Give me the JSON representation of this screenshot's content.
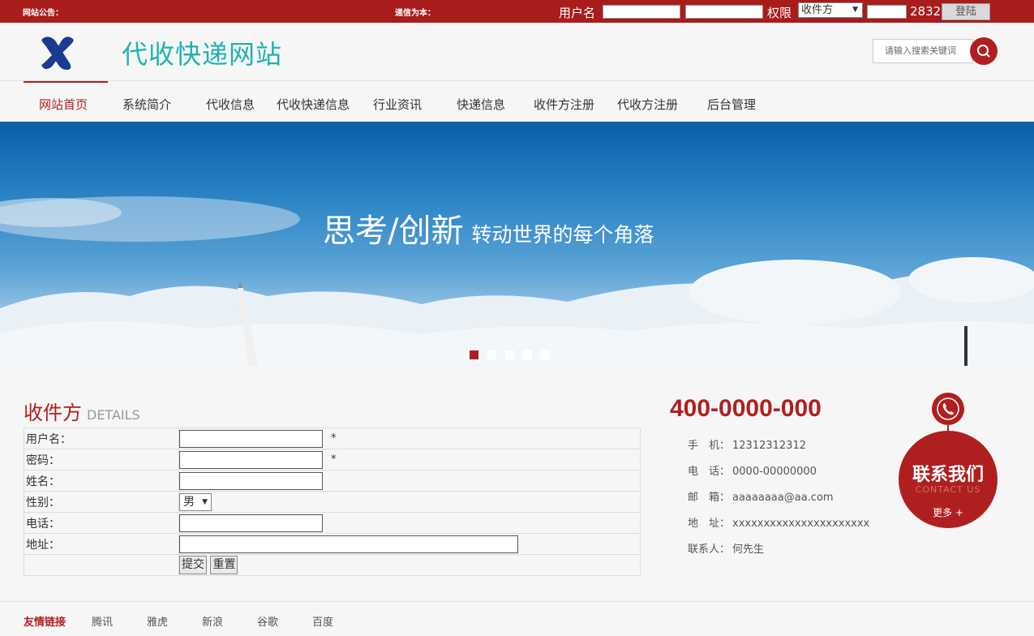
{
  "topbar": {
    "notice_label": "网站公告：",
    "welcome_label": "递信为本：",
    "username_label": "用户名",
    "permission_label": "权限",
    "permission_value": "收件方",
    "captcha_code": "2832",
    "login_button": "登陆"
  },
  "header": {
    "site_title": "代收快递网站",
    "search_placeholder": "请输入搜索关键词"
  },
  "nav": {
    "items": [
      "网站首页",
      "系统简介",
      "代收信息",
      "代收快递信息",
      "行业资讯",
      "快递信息",
      "收件方注册",
      "代收方注册",
      "后台管理"
    ]
  },
  "banner": {
    "slogan_main": "思考/创新",
    "slogan_sub": "转动世界的每个角落"
  },
  "form": {
    "title": "收件方",
    "title_en": "DETAILS",
    "labels": {
      "username": "用户名：",
      "password": "密码：",
      "name": "姓名：",
      "gender": "性别：",
      "phone": "电话：",
      "address": "地址："
    },
    "required_mark": "*",
    "gender_value": "男",
    "submit_button": "提交",
    "reset_button": "重置"
  },
  "contact": {
    "hotline": "400-0000-000",
    "mobile_label": "手　机：",
    "mobile": "12312312312",
    "tel_label": "电　话：",
    "tel": "0000-00000000",
    "email_label": "邮　箱：",
    "email": "aaaaaaaa@aa.com",
    "address_label": "地　址：",
    "address": "xxxxxxxxxxxxxxxxxxxxxx",
    "person_label": "联系人：",
    "person": "何先生",
    "badge_title": "联系我们",
    "badge_en": "CONTACT US",
    "badge_more": "更多 +"
  },
  "footer": {
    "heading": "友情链接",
    "links": [
      "腾讯",
      "雅虎",
      "新浪",
      "谷歌",
      "百度"
    ]
  },
  "colors": {
    "brand_red": "#b01f1f",
    "title_teal": "#1fb3b1"
  }
}
